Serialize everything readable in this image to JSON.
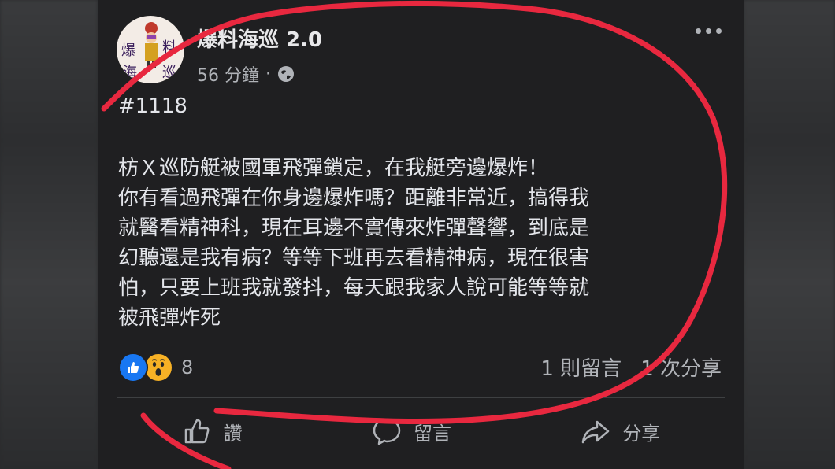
{
  "post": {
    "page_name": "爆料海巡 2.0",
    "time": "56 分鐘",
    "separator": "·",
    "hashtag": "#1118",
    "lines": [
      "枋Ｘ巡防艇被國軍飛彈鎖定，在我艇旁邊爆炸！",
      "你有看過飛彈在你身邊爆炸嗎？距離非常近，搞得我",
      "就醫看精神科，現在耳邊不實傳來炸彈聲響，到底是",
      "幻聽還是我有病？等等下班再去看精神病，現在很害",
      "怕，只要上班我就發抖，每天跟我家人說可能等等就",
      "被飛彈炸死"
    ]
  },
  "avatar_text": [
    "爆",
    "料",
    "海",
    "巡"
  ],
  "reactions": {
    "icons": [
      "like-icon",
      "wow-icon"
    ],
    "count": "8"
  },
  "stats": {
    "comments": "1 則留言",
    "shares": "1 次分享"
  },
  "actions": {
    "like": "讚",
    "comment": "留言",
    "share": "分享"
  },
  "colors": {
    "card_bg": "#1f1f21",
    "text": "#e4e6eb",
    "secondary": "#b0b3b8",
    "like_blue": "#1877f2",
    "wow_yellow": "#f7b125",
    "annotation_red": "#e8283f"
  }
}
